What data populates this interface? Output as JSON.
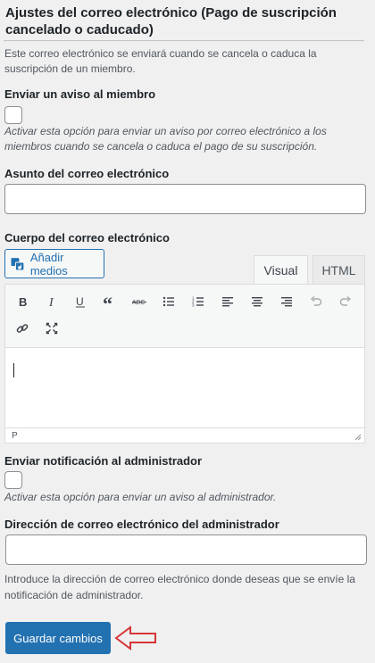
{
  "section": {
    "title": "Ajustes del correo electrónico (Pago de suscripción cancelado o caducado)",
    "description": "Este correo electrónico se enviará cuando se cancela o caduca la suscripción de un miembro."
  },
  "member_notice": {
    "label": "Enviar un aviso al miembro",
    "checked": false,
    "help": "Activar esta opción para enviar un aviso por correo electrónico a los miembros cuando se cancela o caduca el pago de su suscripción."
  },
  "subject": {
    "label": "Asunto del correo electrónico",
    "value": ""
  },
  "body": {
    "label": "Cuerpo del correo electrónico",
    "add_media_label": "Añadir medios",
    "tabs": [
      "Visual",
      "HTML"
    ],
    "active_tab": "Visual",
    "status_path": "P",
    "content": ""
  },
  "toolbar": {
    "buttons": [
      "bold",
      "italic",
      "underline",
      "blockquote",
      "strikethrough",
      "bulleted-list",
      "numbered-list",
      "align-left",
      "align-center",
      "align-right",
      "undo",
      "redo",
      "link",
      "fullscreen"
    ]
  },
  "admin_notice": {
    "label": "Enviar notificación al administrador",
    "checked": false,
    "help": "Activar esta opción para enviar un aviso al administrador."
  },
  "admin_email": {
    "label": "Dirección de correo electrónico del administrador",
    "value": "",
    "help": "Introduce la dirección de correo electrónico donde deseas que se envíe la notificación de administrador."
  },
  "actions": {
    "save_label": "Guardar cambios"
  },
  "colors": {
    "primary": "#2271b1",
    "arrow": "#d63638",
    "background": "#f0f0f1"
  }
}
